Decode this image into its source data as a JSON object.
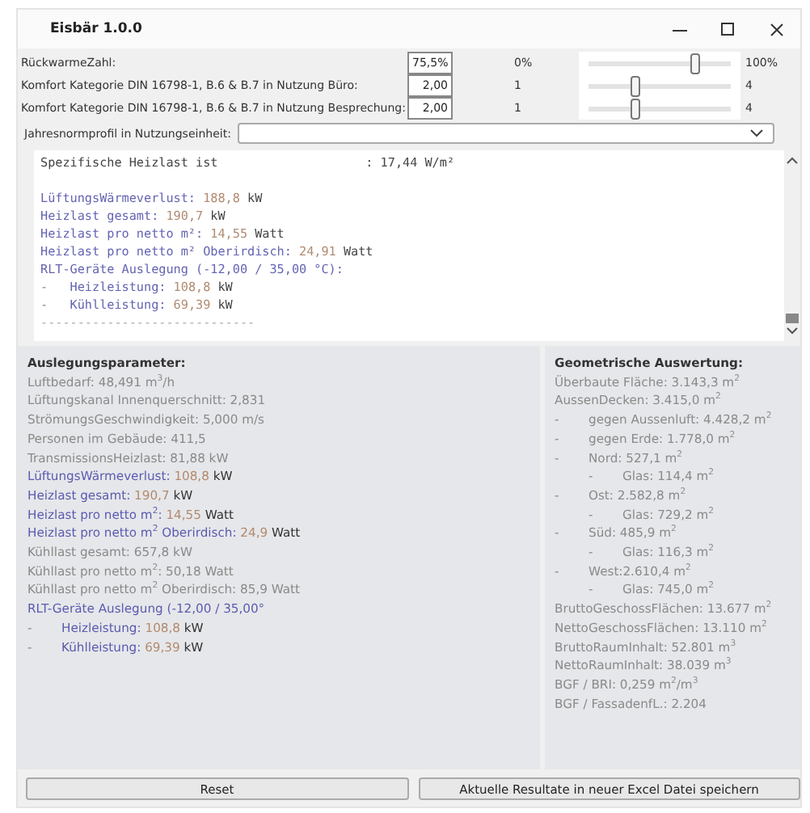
{
  "window": {
    "title": "Eisbär 1.0.0"
  },
  "parameters": [
    {
      "label": "RückwarmeZahl:",
      "value": "75,5%",
      "min": "0%",
      "max": "100%",
      "level": 0.755
    },
    {
      "label": "Komfort Kategorie DIN 16798-1, B.6 & B.7 in Nutzung Büro:",
      "value": "2,00",
      "min": "1",
      "max": "4",
      "level": 0.333
    },
    {
      "label": "Komfort Kategorie DIN 16798-1, B.6 & B.7 in Nutzung Besprechung:",
      "value": "2,00",
      "min": "1",
      "max": "4",
      "level": 0.333
    }
  ],
  "profile": {
    "label": "Jahresnormprofil in Nutzungseinheit:"
  },
  "report": {
    "lines": [
      {
        "segments": [
          {
            "text": "Spezifische Heizlast ist                    : 17,44 W/m²",
            "kind": "plain"
          }
        ]
      },
      {
        "gap_before": true,
        "segments": [
          {
            "text": "LüftungsWärmeverlust: ",
            "kind": "label"
          },
          {
            "text": "188,8",
            "kind": "value"
          },
          {
            "text": " kW",
            "kind": "unit"
          }
        ]
      },
      {
        "segments": [
          {
            "text": "Heizlast gesamt: ",
            "kind": "label"
          },
          {
            "text": "190,7",
            "kind": "value"
          },
          {
            "text": " kW",
            "kind": "unit"
          }
        ]
      },
      {
        "segments": [
          {
            "text": "Heizlast pro netto m²: ",
            "kind": "label"
          },
          {
            "text": "14,55",
            "kind": "value"
          },
          {
            "text": " Watt",
            "kind": "unit"
          }
        ]
      },
      {
        "segments": [
          {
            "text": "Heizlast pro netto m² Oberirdisch: ",
            "kind": "label"
          },
          {
            "text": "24,91",
            "kind": "value"
          },
          {
            "text": " Watt",
            "kind": "unit"
          }
        ]
      },
      {
        "segments": [
          {
            "text": "RLT-Geräte Auslegung (-12,00 / 35,00 °C):",
            "kind": "label"
          }
        ],
        "children": [
          {
            "marker": "-",
            "segments": [
              {
                "text": "Heizleistung: ",
                "kind": "label"
              },
              {
                "text": "108,8",
                "kind": "value"
              },
              {
                "text": " kW",
                "kind": "unit"
              }
            ]
          },
          {
            "marker": "-",
            "segments": [
              {
                "text": "Kühlleistung: ",
                "kind": "label"
              },
              {
                "text": "69,39",
                "kind": "value"
              },
              {
                "text": " kW",
                "kind": "unit"
              }
            ]
          }
        ]
      },
      {
        "segments": [
          {
            "text": "-----------------------------",
            "kind": "rule"
          }
        ]
      }
    ]
  },
  "design_panel": {
    "title": "Auslegungsparameter:",
    "lines": [
      {
        "segments": [
          {
            "text": "Luftbedarf: 48,491 m$^{3}$/h",
            "kind": "plain"
          }
        ]
      },
      {
        "segments": [
          {
            "text": "Lüftungskanal Innenquerschnitt: 2,831",
            "kind": "plain"
          }
        ]
      },
      {
        "segments": [
          {
            "text": "StrömungsGeschwindigkeit: 5,000 m/s",
            "kind": "plain"
          }
        ]
      },
      {
        "segments": [
          {
            "text": "Personen im Gebäude: 411,5",
            "kind": "plain"
          }
        ]
      },
      {
        "segments": [
          {
            "text": "TransmissionsHeizlast: 81,88 kW",
            "kind": "plain"
          }
        ]
      },
      {
        "segments": [
          {
            "text": "LüftungsWärmeverlust: ",
            "kind": "label"
          },
          {
            "text": "108,8",
            "kind": "value"
          },
          {
            "text": " kW",
            "kind": "unit"
          }
        ]
      },
      {
        "segments": [
          {
            "text": "Heizlast gesamt: ",
            "kind": "label"
          },
          {
            "text": "190,7",
            "kind": "value"
          },
          {
            "text": " kW",
            "kind": "unit"
          }
        ]
      },
      {
        "segments": [
          {
            "text": "Heizlast pro netto m$^{2}$: ",
            "kind": "label"
          },
          {
            "text": "14,55",
            "kind": "value"
          },
          {
            "text": " Watt",
            "kind": "unit"
          }
        ]
      },
      {
        "segments": [
          {
            "text": "Heizlast pro netto m$^{2}$ Oberirdisch: ",
            "kind": "label"
          },
          {
            "text": "24,9",
            "kind": "value"
          },
          {
            "text": " Watt",
            "kind": "unit"
          }
        ]
      },
      {
        "segments": [
          {
            "text": "Kühllast gesamt: 657,8 kW",
            "kind": "plain"
          }
        ]
      },
      {
        "segments": [
          {
            "text": "Kühllast pro netto m$^{2}$: 50,18 Watt",
            "kind": "plain"
          }
        ]
      },
      {
        "segments": [
          {
            "text": "Kühllast pro netto m$^{2}$ Oberirdisch: 85,9 Watt",
            "kind": "plain"
          }
        ]
      },
      {
        "segments": [
          {
            "text": "RLT-Geräte Auslegung (-12,00 / 35,00°",
            "kind": "label"
          }
        ],
        "children": [
          {
            "marker": "-",
            "segments": [
              {
                "text": "Heizleistung: ",
                "kind": "label"
              },
              {
                "text": "108,8",
                "kind": "value"
              },
              {
                "text": " kW",
                "kind": "unit"
              }
            ]
          },
          {
            "marker": "-",
            "segments": [
              {
                "text": "Kühlleistung: ",
                "kind": "label"
              },
              {
                "text": "69,39",
                "kind": "value"
              },
              {
                "text": " kW",
                "kind": "unit"
              }
            ]
          }
        ]
      }
    ]
  },
  "geometry_panel": {
    "title": "Geometrische Auswertung:",
    "lines": [
      {
        "segments": [
          {
            "text": "Überbaute Fläche: 3.143,3 m$^{2}$",
            "kind": "plain"
          }
        ]
      },
      {
        "segments": [
          {
            "text": "AussenDecken: 3.415,0 m$^{2}$",
            "kind": "plain"
          }
        ],
        "children": [
          {
            "marker": "-",
            "segments": [
              {
                "text": "gegen Aussenluft: 4.428,2 m$^{2}$",
                "kind": "plain"
              }
            ]
          },
          {
            "marker": "-",
            "segments": [
              {
                "text": "gegen Erde: 1.778,0 m$^{2}$",
                "kind": "plain"
              }
            ]
          },
          {
            "marker": "-",
            "segments": [
              {
                "text": "Nord: 527,1 m$^{2}$",
                "kind": "plain"
              }
            ],
            "children": [
              {
                "marker": "-",
                "segments": [
                  {
                    "text": "Glas: 114,4 m$^{2}$",
                    "kind": "plain"
                  }
                ]
              }
            ]
          },
          {
            "marker": "-",
            "segments": [
              {
                "text": "Ost: 2.582,8 m$^{2}$",
                "kind": "plain"
              }
            ],
            "children": [
              {
                "marker": "-",
                "segments": [
                  {
                    "text": "Glas: 729,2 m$^{2}$",
                    "kind": "plain"
                  }
                ]
              }
            ]
          },
          {
            "marker": "-",
            "segments": [
              {
                "text": "Süd: 485,9 m$^{2}$",
                "kind": "plain"
              }
            ],
            "children": [
              {
                "marker": "-",
                "segments": [
                  {
                    "text": "Glas: 116,3 m$^{2}$",
                    "kind": "plain"
                  }
                ]
              }
            ]
          },
          {
            "marker": "-",
            "segments": [
              {
                "text": "West:2.610,4 m$^{2}$",
                "kind": "plain"
              }
            ],
            "children": [
              {
                "marker": "-",
                "segments": [
                  {
                    "text": "Glas: 745,0 m$^{2}$",
                    "kind": "plain"
                  }
                ]
              }
            ]
          }
        ]
      },
      {
        "segments": [
          {
            "text": "BruttoGeschossFlächen: 13.677 m$^{2}$",
            "kind": "plain"
          }
        ]
      },
      {
        "segments": [
          {
            "text": "NettoGeschossFlächen: 13.110 m$^{2}$",
            "kind": "plain"
          }
        ]
      },
      {
        "segments": [
          {
            "text": "BruttoRaumInhalt: 52.801 m$^{3}$",
            "kind": "plain"
          }
        ]
      },
      {
        "segments": [
          {
            "text": "NettoRaumInhalt: 38.039 m$^{3}$",
            "kind": "plain"
          }
        ]
      },
      {
        "segments": [
          {
            "text": "BGF / BRI: 0,259 m$^{2}$/m$^{3}$",
            "kind": "plain"
          }
        ]
      },
      {
        "segments": [
          {
            "text": "BGF / FassadenfL.: 2.204",
            "kind": "plain"
          }
        ]
      }
    ]
  },
  "buttons": [
    {
      "label": "Reset"
    },
    {
      "label": "Aktuelle Resultate in neuer Excel Datei speichern"
    }
  ]
}
